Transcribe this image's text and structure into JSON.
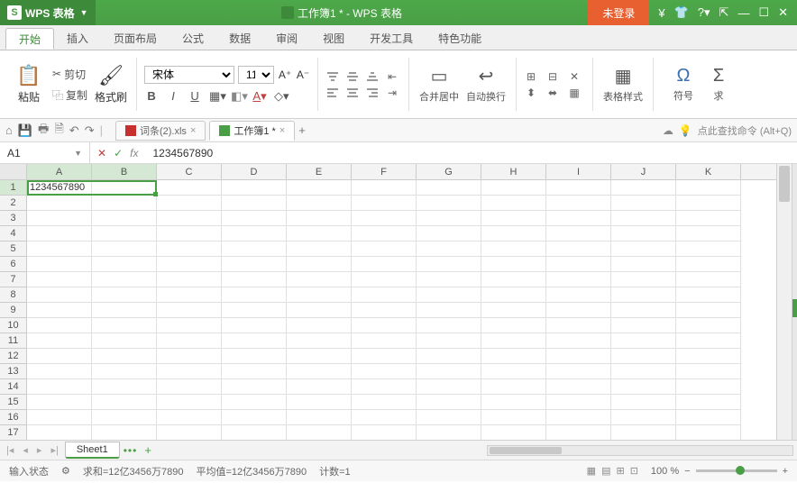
{
  "app": {
    "name": "WPS 表格",
    "title": "工作簿1 * - WPS 表格",
    "login": "未登录"
  },
  "menu": {
    "tabs": [
      "开始",
      "插入",
      "页面布局",
      "公式",
      "数据",
      "审阅",
      "视图",
      "开发工具",
      "特色功能"
    ],
    "active": 0
  },
  "ribbon": {
    "paste": "粘贴",
    "cut": "剪切",
    "copy": "复制",
    "format_painter": "格式刷",
    "font_name": "宋体",
    "font_size": "11",
    "merge": "合并居中",
    "wrap": "自动换行",
    "style": "表格样式",
    "symbol": "符号",
    "sum": "求"
  },
  "quick": {
    "doc_tabs": [
      {
        "label": "词条(2).xls",
        "active": false,
        "icon": "red"
      },
      {
        "label": "工作簿1 *",
        "active": true,
        "icon": "green"
      }
    ],
    "search_hint": "点此查找命令 (Alt+Q)"
  },
  "formula_bar": {
    "name_box": "A1",
    "value": "1234567890"
  },
  "grid": {
    "columns": [
      "A",
      "B",
      "C",
      "D",
      "E",
      "F",
      "G",
      "H",
      "I",
      "J",
      "K"
    ],
    "selected_cols": [
      "A",
      "B"
    ],
    "rows": 17,
    "selected_row": 1,
    "data": {
      "A1": "1234567890"
    }
  },
  "sheet_tabs": {
    "active": "Sheet1"
  },
  "status": {
    "mode": "输入状态",
    "stats": [
      "求和=12亿3456万7890",
      "平均值=12亿3456万7890",
      "计数=1"
    ],
    "zoom": "100 %"
  }
}
